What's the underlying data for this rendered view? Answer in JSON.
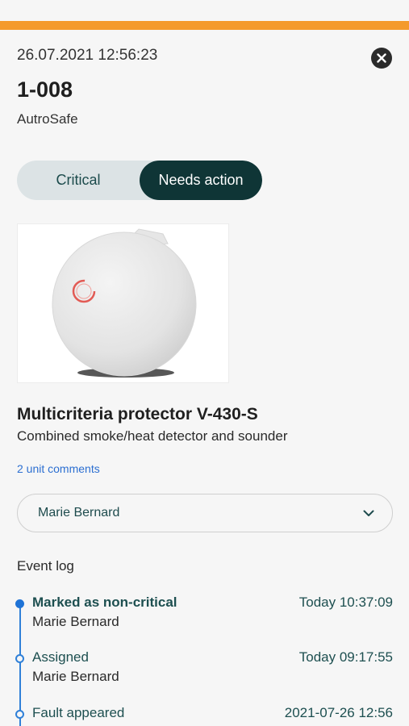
{
  "header": {
    "timestamp": "26.07.2021 12:56:23",
    "unit_id": "1-008",
    "system": "AutroSafe",
    "accent_color": "#f49a2c",
    "close_icon": "close-icon"
  },
  "status_toggle": {
    "options": [
      "Critical",
      "Needs action"
    ],
    "selected": "Needs action"
  },
  "product": {
    "image_icon": "smoke-detector-image",
    "name": "Multicriteria protector V-430-S",
    "description": "Combined smoke/heat detector and sounder",
    "comments_link": "2 unit comments"
  },
  "assignee": {
    "selected": "Marie Bernard",
    "icon": "chevron-down-icon"
  },
  "event_log": {
    "title": "Event log",
    "events": [
      {
        "title": "Marked as non-critical",
        "user": "Marie Bernard",
        "time": "Today 10:37:09"
      },
      {
        "title": "Assigned",
        "user": "Marie Bernard",
        "time": "Today 09:17:55"
      },
      {
        "title": "Fault appeared",
        "user": "",
        "time": "2021-07-26 12:56"
      }
    ]
  }
}
